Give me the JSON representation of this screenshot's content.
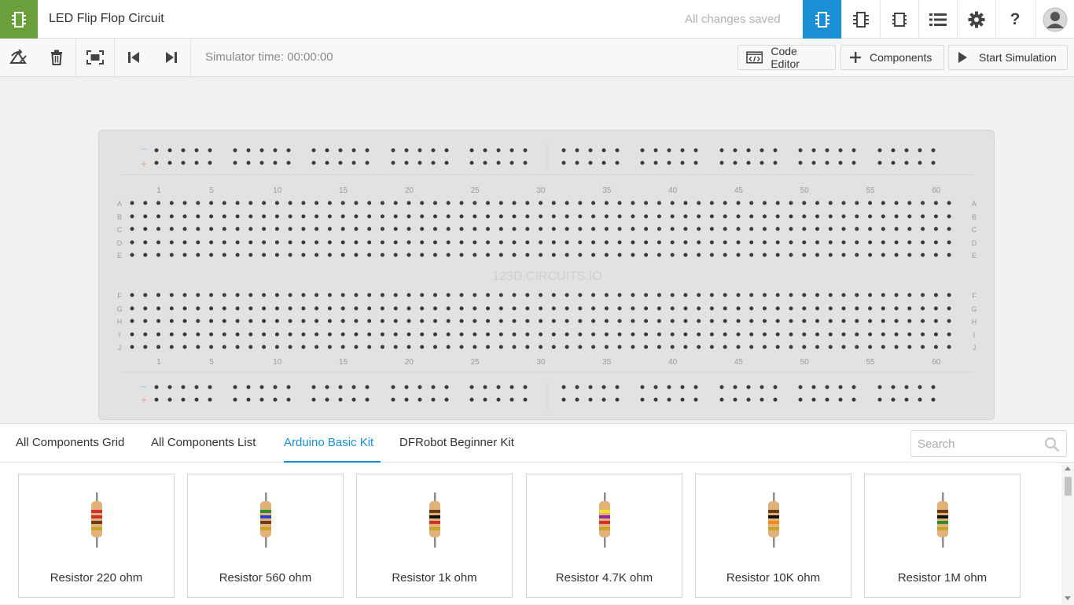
{
  "header": {
    "title": "LED Flip Flop Circuit",
    "save_status": "All changes saved",
    "buttons": [
      {
        "name": "breadboard-view-icon",
        "active": true
      },
      {
        "name": "schematic-view-icon",
        "active": false
      },
      {
        "name": "pcb-view-icon",
        "active": false
      },
      {
        "name": "component-list-icon",
        "active": false
      },
      {
        "name": "gear-icon",
        "active": false
      },
      {
        "name": "help-icon",
        "active": false,
        "glyph": "?"
      },
      {
        "name": "avatar-icon",
        "active": false
      }
    ],
    "brand_color": "#6a9f3c",
    "accent_color": "#1a8fd4"
  },
  "toolbar": {
    "tools": [
      "rotate-icon",
      "trash-icon",
      "fit-to-screen-icon",
      "skip-back-icon",
      "skip-forward-icon"
    ],
    "sim_time": "Simulator time: 00:00:00",
    "code_editor": "Code Editor",
    "components": "Components",
    "start_simulation": "Start Simulation"
  },
  "breadboard": {
    "watermark": "123D.CIRCUITS.IO",
    "rail_minus": "−",
    "rail_plus": "+",
    "column_numbers": [
      "1",
      "5",
      "10",
      "15",
      "20",
      "25",
      "30",
      "35",
      "40",
      "45",
      "50",
      "55",
      "60"
    ],
    "rows_top": [
      "A",
      "B",
      "C",
      "D",
      "E"
    ],
    "rows_bottom": [
      "F",
      "G",
      "H",
      "I",
      "J"
    ],
    "column_count": 63,
    "rail_groups": 10,
    "rail_color_minus": "#9ec8ea",
    "rail_color_plus": "#f0a0a0"
  },
  "panel": {
    "tabs": [
      {
        "label": "All Components Grid",
        "active": false
      },
      {
        "label": "All Components List",
        "active": false
      },
      {
        "label": "Arduino Basic Kit",
        "active": true
      },
      {
        "label": "DFRobot Beginner Kit",
        "active": false
      }
    ],
    "search_placeholder": "Search",
    "components": [
      {
        "label": "Resistor 220 ohm",
        "bands": [
          "#d32f2f",
          "#d32f2f",
          "#6d3b17",
          "#c9a227"
        ]
      },
      {
        "label": "Resistor 560 ohm",
        "bands": [
          "#2e8b2e",
          "#2a3fd6",
          "#6d3b17",
          "#c9a227"
        ]
      },
      {
        "label": "Resistor 1k ohm",
        "bands": [
          "#6d3b17",
          "#111111",
          "#d32f2f",
          "#c9a227"
        ]
      },
      {
        "label": "Resistor 4.7K ohm",
        "bands": [
          "#f2e02a",
          "#8e2a9e",
          "#d32f2f",
          "#c9a227"
        ]
      },
      {
        "label": "Resistor 10K ohm",
        "bands": [
          "#6d3b17",
          "#111111",
          "#f28a1a",
          "#c9a227"
        ]
      },
      {
        "label": "Resistor 1M ohm",
        "bands": [
          "#6d3b17",
          "#111111",
          "#2e8b2e",
          "#c9a227"
        ]
      }
    ]
  }
}
